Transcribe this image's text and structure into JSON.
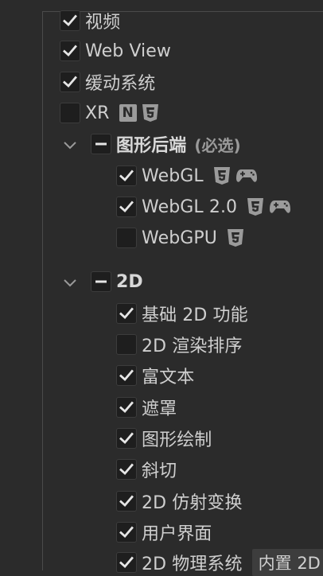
{
  "items": {
    "video": {
      "label": "视频",
      "checked": true
    },
    "webview": {
      "label": "Web View",
      "checked": true
    },
    "tween": {
      "label": "缓动系统",
      "checked": true
    },
    "xr": {
      "label": "XR",
      "checked": false,
      "badges": [
        "native-icon",
        "html5-icon"
      ]
    },
    "graphics_group": {
      "label": "图形后端",
      "note": "(必选)",
      "state": "indeterminate"
    },
    "webgl": {
      "label": "WebGL",
      "checked": true,
      "badges": [
        "html5-icon",
        "gamepad-icon"
      ]
    },
    "webgl2": {
      "label": "WebGL 2.0",
      "checked": true,
      "badges": [
        "html5-icon",
        "gamepad-icon"
      ]
    },
    "webgpu": {
      "label": "WebGPU",
      "checked": false,
      "badges": [
        "html5-icon"
      ]
    },
    "group_2d": {
      "label": "2D",
      "state": "indeterminate"
    },
    "basic2d": {
      "label": "基础 2D 功能",
      "checked": true
    },
    "sort2d": {
      "label": "2D 渲染排序",
      "checked": false
    },
    "richtext": {
      "label": "富文本",
      "checked": true
    },
    "mask": {
      "label": "遮罩",
      "checked": true
    },
    "graphics": {
      "label": "图形绘制",
      "checked": true
    },
    "skew": {
      "label": "斜切",
      "checked": true
    },
    "affine": {
      "label": "2D 仿射变换",
      "checked": true
    },
    "ui": {
      "label": "用户界面",
      "checked": true
    },
    "physics2d": {
      "label": "2D 物理系统",
      "checked": true,
      "tag": "内置 2D"
    }
  },
  "colors": {
    "background": "#2b2b2b",
    "checkbox": "#1e1e1e",
    "text": "#cfcfcf",
    "muted": "#9a9a9a"
  }
}
